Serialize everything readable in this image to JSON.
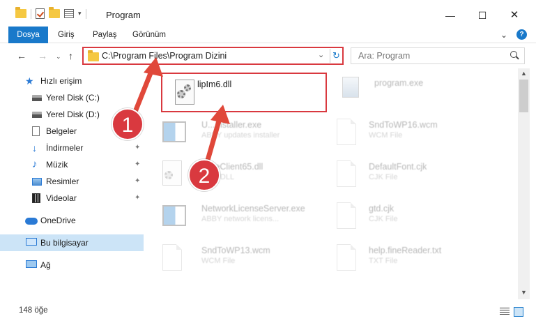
{
  "window": {
    "title": "Program",
    "controls": {
      "minimize": "—",
      "maximize": "☐",
      "close": "✕"
    }
  },
  "ribbon": {
    "tabs": [
      "Dosya",
      "Giriş",
      "Paylaş",
      "Görünüm"
    ],
    "collapse_icon": "chevron-down-icon",
    "help": "?"
  },
  "nav": {
    "back": "←",
    "forward": "→",
    "recent": "⌄",
    "up": "↑",
    "address": "C:\\Program Files\\Program Dizini",
    "address_dropdown": "⌄",
    "refresh": "↻",
    "search_placeholder": "Ara: Program"
  },
  "sidebar": {
    "items": [
      {
        "label": "Hızlı erişim",
        "icon": "star-icon",
        "pinned": false
      },
      {
        "label": "Yerel Disk (C:)",
        "icon": "drive-icon",
        "pinned": false
      },
      {
        "label": "Yerel Disk (D:)",
        "icon": "drive-icon",
        "pinned": false
      },
      {
        "label": "Belgeler",
        "icon": "documents-icon",
        "pinned": true
      },
      {
        "label": "İndirmeler",
        "icon": "downloads-icon",
        "pinned": true
      },
      {
        "label": "Müzik",
        "icon": "music-icon",
        "pinned": true
      },
      {
        "label": "Resimler",
        "icon": "pictures-icon",
        "pinned": true
      },
      {
        "label": "Videolar",
        "icon": "videos-icon",
        "pinned": true
      },
      {
        "label": "OneDrive",
        "icon": "cloud-icon",
        "pinned": false
      },
      {
        "label": "Bu bilgisayar",
        "icon": "computer-icon",
        "pinned": false,
        "selected": true
      },
      {
        "label": "Ağ",
        "icon": "network-icon",
        "pinned": false
      }
    ],
    "pin_glyph": "📌"
  },
  "files": [
    {
      "name": "lipIm6.dll",
      "sub": "",
      "icon": "dll-icon",
      "highlighted": true
    },
    {
      "name": "program.exe",
      "sub": "",
      "icon": "exe-icon"
    },
    {
      "name": "U...Installer.exe",
      "sub": "ABBY updates installer",
      "icon": "app-icon"
    },
    {
      "name": "SndToWP16.wcm",
      "sub": "WCM File",
      "icon": "file-icon"
    },
    {
      "name": "U...eClient65.dll",
      "sub": "...ion DLL",
      "icon": "dll-icon"
    },
    {
      "name": "DefaultFont.cjk",
      "sub": "CJK File",
      "icon": "file-icon"
    },
    {
      "name": "NetworkLicenseServer.exe",
      "sub": "ABBY network licens...",
      "icon": "app-icon"
    },
    {
      "name": "gtd.cjk",
      "sub": "CJK File",
      "icon": "file-icon"
    },
    {
      "name": "SndToWP13.wcm",
      "sub": "WCM File",
      "icon": "file-icon"
    },
    {
      "name": "help.fineReader.txt",
      "sub": "TXT File",
      "icon": "file-icon"
    }
  ],
  "status": {
    "item_count": "148 öğe"
  },
  "annotations": {
    "step1": "1",
    "step2": "2"
  },
  "colors": {
    "accent": "#1979ca",
    "highlight": "#d9393f",
    "selection": "#cce4f7"
  }
}
